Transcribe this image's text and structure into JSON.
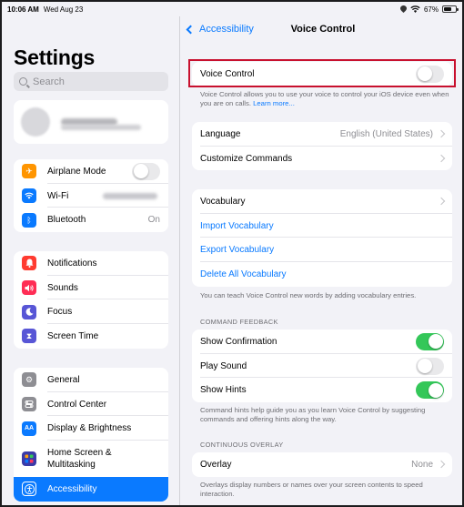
{
  "status_bar": {
    "time": "10:06 AM",
    "date": "Wed Aug 23",
    "battery": "67%",
    "battery_level": 0.67
  },
  "sidebar": {
    "title": "Settings",
    "search_placeholder": "Search",
    "group1": [
      {
        "label": "Airplane Mode",
        "icon": "airplane-icon",
        "color": "#ff9500",
        "toggle": false
      },
      {
        "label": "Wi-Fi",
        "icon": "wifi-icon",
        "color": "#0a7aff"
      },
      {
        "label": "Bluetooth",
        "icon": "bluetooth-icon",
        "color": "#0a7aff",
        "value": "On"
      }
    ],
    "group2": [
      {
        "label": "Notifications",
        "icon": "bell-icon",
        "color": "#ff3b30"
      },
      {
        "label": "Sounds",
        "icon": "speaker-icon",
        "color": "#ff2d55"
      },
      {
        "label": "Focus",
        "icon": "moon-icon",
        "color": "#5856d6"
      },
      {
        "label": "Screen Time",
        "icon": "hourglass-icon",
        "color": "#5856d6"
      }
    ],
    "group3": [
      {
        "label": "General",
        "icon": "gear-icon",
        "color": "#8e8e93"
      },
      {
        "label": "Control Center",
        "icon": "toggles-icon",
        "color": "#8e8e93"
      },
      {
        "label": "Display & Brightness",
        "icon": "text-size-icon",
        "color": "#0a7aff"
      },
      {
        "label": "Home Screen &",
        "label2": "Multitasking",
        "icon": "grid-icon",
        "color": "#3a3aa8"
      },
      {
        "label": "Accessibility",
        "icon": "accessibility-icon",
        "color": "#0a7aff",
        "active": true
      }
    ]
  },
  "detail": {
    "back_label": "Accessibility",
    "title": "Voice Control",
    "voice_control": {
      "label": "Voice Control",
      "enabled": false
    },
    "voice_note": "Voice Control allows you to use your voice to control your iOS device even when you are on calls.",
    "voice_note_link": "Learn more...",
    "language": {
      "label": "Language",
      "value": "English (United States)"
    },
    "customize": "Customize Commands",
    "vocabulary": "Vocabulary",
    "import_vocab": "Import Vocabulary",
    "export_vocab": "Export Vocabulary",
    "delete_vocab": "Delete All Vocabulary",
    "vocab_note": "You can teach Voice Control new words by adding vocabulary entries.",
    "feedback_header": "COMMAND FEEDBACK",
    "show_confirmation": {
      "label": "Show Confirmation",
      "enabled": true
    },
    "play_sound": {
      "label": "Play Sound",
      "enabled": false
    },
    "show_hints": {
      "label": "Show Hints",
      "enabled": true
    },
    "hints_note": "Command hints help guide you as you learn Voice Control by suggesting commands and offering hints along the way.",
    "overlay_header": "CONTINUOUS OVERLAY",
    "overlay": {
      "label": "Overlay",
      "value": "None"
    },
    "overlay_note": "Overlays display numbers or names over your screen contents to speed interaction."
  },
  "colors": {
    "accent": "#0a7aff",
    "toggle_on": "#34c759",
    "highlight": "#c8102e"
  }
}
